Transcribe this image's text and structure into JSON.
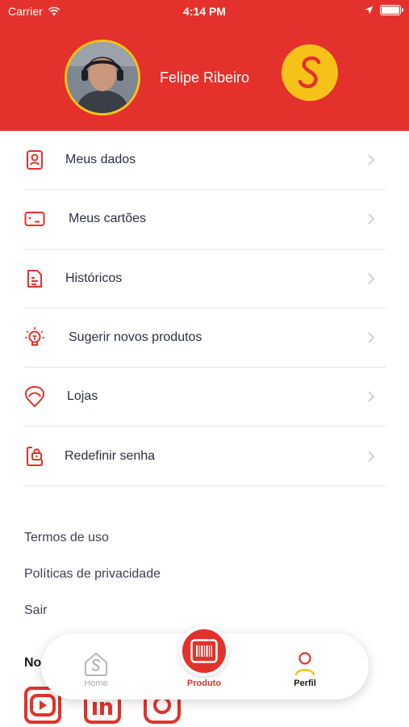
{
  "status_bar": {
    "carrier": "Carrier",
    "time": "4:14 PM"
  },
  "profile": {
    "name": "Felipe Ribeiro",
    "brand_letter": "S"
  },
  "menu": [
    {
      "label": "Meus dados",
      "icon": "id-badge-icon"
    },
    {
      "label": "Meus cartões",
      "icon": "card-icon"
    },
    {
      "label": "Históricos",
      "icon": "document-icon"
    },
    {
      "label": "Sugerir novos produtos",
      "icon": "lightbulb-icon"
    },
    {
      "label": "Lojas",
      "icon": "location-icon"
    },
    {
      "label": "Redefinir senha",
      "icon": "phone-lock-icon"
    }
  ],
  "links": {
    "terms": "Termos de uso",
    "privacy": "Políticas de privacidade",
    "logout": "Sair"
  },
  "social": {
    "title": "No",
    "icons": [
      "youtube-icon",
      "linkedin-icon",
      "instagram-icon"
    ]
  },
  "tabbar": {
    "home": "Home",
    "produto": "Produto",
    "perfil": "Perfil",
    "active": "Perfil"
  },
  "colors": {
    "primary": "#e4312b",
    "accent": "#f6c21a",
    "text": "#2a2f45"
  }
}
